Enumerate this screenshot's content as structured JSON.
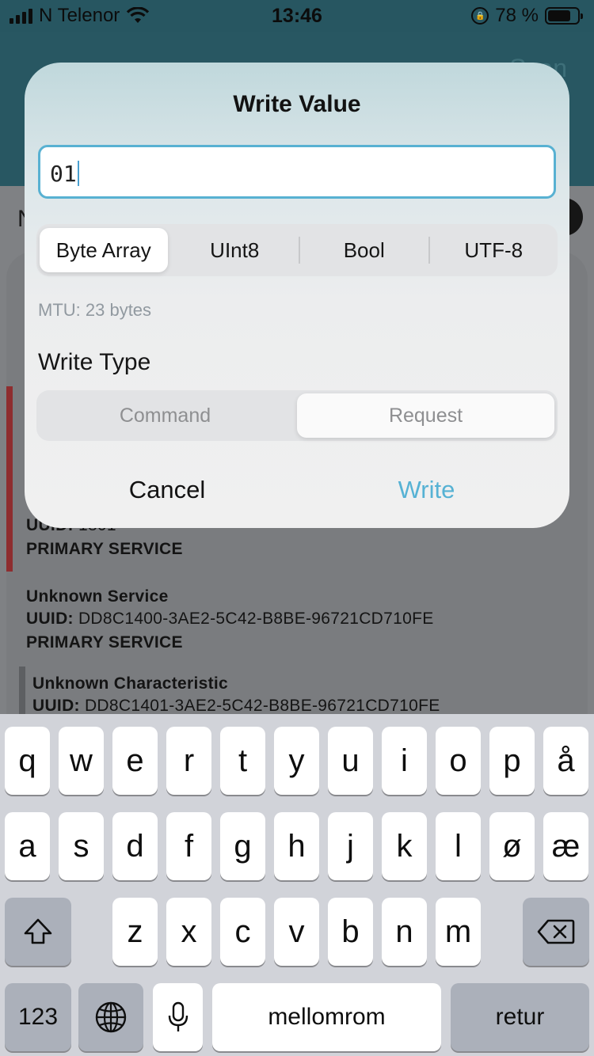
{
  "status_bar": {
    "carrier": "N Telenor",
    "time": "13:46",
    "battery_percent": "78 %",
    "battery_level": 0.78
  },
  "header": {
    "scan_label": "Scan"
  },
  "background": {
    "partial_letter": "N",
    "services": [
      {
        "uuid_label": "UUID:",
        "uuid": "1801",
        "kind": "PRIMARY SERVICE"
      },
      {
        "name": "Unknown Service",
        "uuid_label": "UUID:",
        "uuid": "DD8C1400-3AE2-5C42-B8BE-96721CD710FE",
        "kind": "PRIMARY SERVICE"
      }
    ],
    "characteristic": {
      "name": "Unknown Characteristic",
      "uuid_label": "UUID:",
      "uuid": "DD8C1401-3AE2-5C42-B8BE-96721CD710FE"
    }
  },
  "dialog": {
    "title": "Write Value",
    "input_value": "01",
    "formats": [
      "Byte Array",
      "UInt8",
      "Bool",
      "UTF-8"
    ],
    "selected_format": "Byte Array",
    "mtu_text": "MTU: 23 bytes",
    "write_type_label": "Write Type",
    "write_types": [
      "Command",
      "Request"
    ],
    "selected_write_type": "Request",
    "cancel_label": "Cancel",
    "write_label": "Write"
  },
  "keyboard": {
    "row1": [
      "q",
      "w",
      "e",
      "r",
      "t",
      "y",
      "u",
      "i",
      "o",
      "p",
      "å"
    ],
    "row2": [
      "a",
      "s",
      "d",
      "f",
      "g",
      "h",
      "j",
      "k",
      "l",
      "ø",
      "æ"
    ],
    "row3": [
      "z",
      "x",
      "c",
      "v",
      "b",
      "n",
      "m"
    ],
    "numbers_label": "123",
    "space_label": "mellomrom",
    "return_label": "retur",
    "icons": {
      "shift": "shift-icon",
      "backspace": "backspace-icon",
      "globe": "globe-icon",
      "mic": "microphone-icon"
    }
  }
}
